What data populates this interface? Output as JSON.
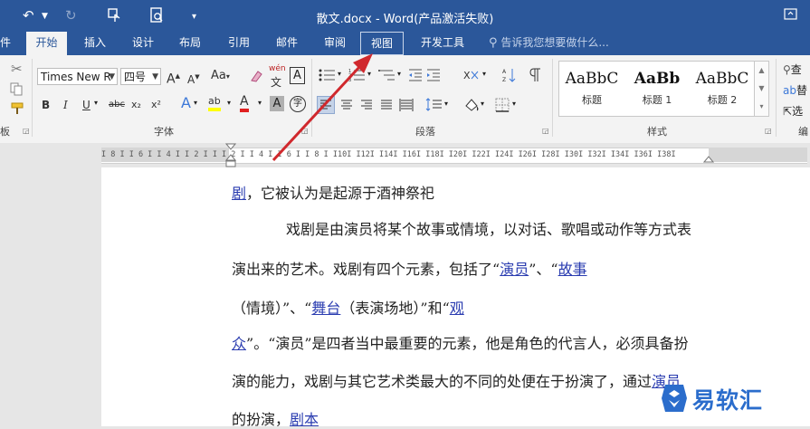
{
  "window": {
    "title": "散文.docx - Word(产品激活失败)"
  },
  "quick_access": {
    "undo_icon": "undo-icon",
    "redo_icon": "redo-icon",
    "touch_mode_icon": "touch-mode-icon",
    "print_preview_icon": "print-preview-icon",
    "customize_icon": "chevron-down-icon"
  },
  "tabs": [
    {
      "label": "件"
    },
    {
      "label": "开始"
    },
    {
      "label": "插入"
    },
    {
      "label": "设计"
    },
    {
      "label": "布局"
    },
    {
      "label": "引用"
    },
    {
      "label": "邮件"
    },
    {
      "label": "审阅"
    },
    {
      "label": "视图"
    },
    {
      "label": "开发工具"
    }
  ],
  "tell_me": "告诉我您想要做什么...",
  "ribbon": {
    "font": {
      "name": "Times New R",
      "size": "四号",
      "group_label": "字体",
      "grow": "A",
      "shrink": "A",
      "case": "Aa",
      "phonetic": "wén",
      "border_char": "A",
      "bold": "B",
      "italic": "I",
      "underline": "U",
      "strike": "abc",
      "subscript": "x₂",
      "superscript": "x²",
      "effects": "A",
      "highlight": "ab",
      "color": "A",
      "shade": "A",
      "circle": "字"
    },
    "paragraph": {
      "group_label": "段落"
    },
    "styles": {
      "group_label": "样式",
      "items": [
        {
          "sample": "AaBbC",
          "name": "标题"
        },
        {
          "sample": "AaBb",
          "name": "标题 1"
        },
        {
          "sample": "AaBbC",
          "name": "标题 2"
        }
      ]
    },
    "editing": {
      "find": "查",
      "replace": "替",
      "select": "选",
      "group_label": "编"
    },
    "clipboard": {
      "group_label": "板"
    }
  },
  "ruler": {
    "ticks": "I 8 I  I 6 I  I 4 I  I 2 I   I  I 2 I  I 4 I  I 6 I  I 8 I  I10I  I12I  I14I  I16I  I18I  I20I  I22I  I24I  I26I  I28I  I30I  I32I  I34I  I36I  I38I"
  },
  "document": {
    "lines": [
      {
        "parts": [
          {
            "t": "剧",
            "link": true
          },
          {
            "t": "，它被认为是起源于酒神祭祀",
            "link": false
          }
        ]
      },
      {
        "parts": [
          {
            "t": "戏剧是由演员将某个故事或情境，以对话、歌唱或动作等方式表",
            "link": false
          }
        ]
      },
      {
        "parts": [
          {
            "t": "演出来的艺术。戏剧有四个元素，包括了“",
            "link": false
          },
          {
            "t": "演员",
            "link": true
          },
          {
            "t": "”、“",
            "link": false
          },
          {
            "t": "故事",
            "link": true
          }
        ]
      },
      {
        "parts": [
          {
            "t": "（情境）”、“",
            "link": false
          },
          {
            "t": "舞台",
            "link": true
          },
          {
            "t": "（表演场地）”和“",
            "link": false
          },
          {
            "t": "观",
            "link": true
          }
        ]
      },
      {
        "parts": [
          {
            "t": "众",
            "link": true
          },
          {
            "t": "”。“演员”是四者当中最重要的元素，他是角色的代言人，必须具备扮",
            "link": false
          }
        ]
      },
      {
        "parts": [
          {
            "t": "演的能力，戏剧与其它艺术类最大的不同的处便在于扮演了，通过",
            "link": false
          },
          {
            "t": "演员",
            "link": true
          }
        ]
      },
      {
        "parts": [
          {
            "t": "的扮演，",
            "link": false
          },
          {
            "t": "剧本",
            "link": true
          }
        ]
      }
    ]
  },
  "watermark": {
    "text": "易软汇"
  },
  "colors": {
    "accent": "#2b579a",
    "link": "#2a3cb0",
    "arrow": "#d0282d",
    "watermark": "#2b6dcc"
  }
}
